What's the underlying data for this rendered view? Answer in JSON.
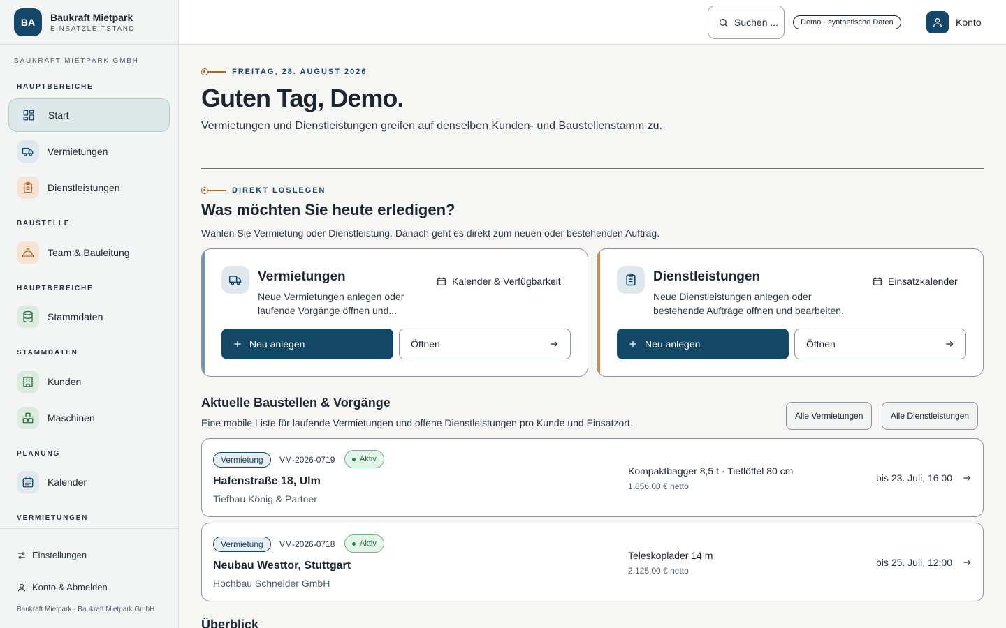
{
  "brand": {
    "badge": "BA",
    "name": "Baukraft Mietpark",
    "subtitle": "EINSATZLEITSTAND"
  },
  "sidebar": {
    "company": "BAUKRAFT MIETPARK GMBH",
    "sections": [
      "HAUPTBEREICHE",
      "BAUSTELLE",
      "HAUPTBEREICHE",
      "STAMMDATEN",
      "PLANUNG",
      "VERMIETUNGEN"
    ],
    "items": [
      {
        "label": "Start",
        "icon": "grid-icon",
        "active": true
      },
      {
        "label": "Vermietungen",
        "icon": "truck-icon"
      },
      {
        "label": "Dienstleistungen",
        "icon": "clipboard-icon"
      },
      {
        "label": "Team & Bauleitung",
        "icon": "hardhat-icon"
      },
      {
        "label": "Stammdaten",
        "icon": "database-icon"
      },
      {
        "label": "Kunden",
        "icon": "building-icon"
      },
      {
        "label": "Maschinen",
        "icon": "boxes-icon"
      },
      {
        "label": "Kalender",
        "icon": "calendar-icon"
      }
    ],
    "bottom": {
      "settings": "Einstellungen",
      "account": "Konto & Abmelden",
      "footer": "Baukraft Mietpark · Baukraft Mietpark GmbH"
    }
  },
  "header": {
    "search_label": "Suchen ...",
    "demo_badge": "Demo · synthetische Daten",
    "account_label": "Konto"
  },
  "hero": {
    "date": "FREITAG, 28. AUGUST 2026",
    "title": "Guten Tag, Demo.",
    "text": "Vermietungen und Dienstleistungen greifen auf denselben Kunden- und Baustellenstamm zu."
  },
  "quickstart": {
    "eyebrow": "DIREKT LOSLEGEN",
    "title": "Was möchten Sie heute erledigen?",
    "text": "Wählen Sie Vermietung oder Dienstleistung. Danach geht es direkt zum neuen oder bestehenden Auftrag.",
    "cards": [
      {
        "title": "Vermietungen",
        "description": "Neue Vermietungen anlegen oder laufende Vorgänge öffnen und...",
        "link": "Kalender & Verfügbarkeit",
        "new_label": "Neu anlegen",
        "open_label": "Öffnen"
      },
      {
        "title": "Dienstleistungen",
        "description": "Neue Dienstleistungen anlegen oder bestehende Aufträge öffnen und bearbeiten.",
        "link": "Einsatzkalender",
        "new_label": "Neu anlegen",
        "open_label": "Öffnen"
      }
    ]
  },
  "current": {
    "title": "Aktuelle Baustellen & Vorgänge",
    "text": "Eine mobile Liste für laufende Vermietungen und offene Dienstleistungen pro Kunde und Einsatzort.",
    "btn_rentals": "Alle Vermietungen",
    "btn_services": "Alle Dienstleistungen",
    "rows": [
      {
        "type": "Vermietung",
        "id": "VM-2026-0719",
        "status": "Aktiv",
        "title": "Hafenstraße 18, Ulm",
        "customer": "Tiefbau König & Partner",
        "machine": "Kompaktbagger 8,5 t · Tieflöffel 80 cm",
        "price": "1.856,00 € netto",
        "until": "bis 23. Juli, 16:00"
      },
      {
        "type": "Vermietung",
        "id": "VM-2026-0718",
        "status": "Aktiv",
        "title": "Neubau Westtor, Stuttgart",
        "customer": "Hochbau Schneider GmbH",
        "machine": "Teleskoplader 14 m",
        "price": "2.125,00 € netto",
        "until": "bis 25. Juli, 12:00"
      }
    ]
  },
  "overview_title": "Überblick",
  "colors": {
    "primary": "#124766",
    "accent": "#b3611f",
    "success": "#1f8a48"
  }
}
